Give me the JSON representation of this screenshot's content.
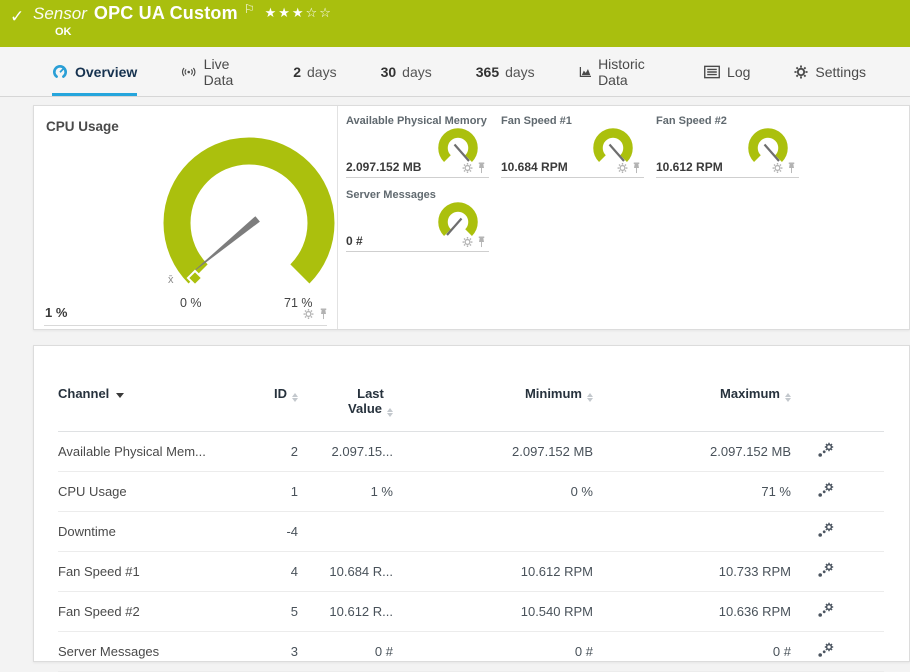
{
  "header": {
    "check_icon": "✓",
    "kind": "Sensor",
    "name": "OPC UA Custom",
    "flag_icon": "⚐",
    "stars": "★★★☆☆",
    "status": "OK"
  },
  "tabs": [
    {
      "label": "Overview"
    },
    {
      "label": "Live Data"
    },
    {
      "num": "2",
      "unit": "days"
    },
    {
      "num": "30",
      "unit": "days"
    },
    {
      "num": "365",
      "unit": "days"
    },
    {
      "label": "Historic Data"
    },
    {
      "label": "Log"
    },
    {
      "label": "Settings"
    }
  ],
  "gauges": {
    "cpu": {
      "title": "CPU Usage",
      "current": "1 %",
      "scale_min": "0 %",
      "scale_max": "71 %",
      "mean_marker": "x̄"
    },
    "mini": [
      {
        "title": "Available Physical Memory",
        "value": "2.097.152 MB"
      },
      {
        "title": "Fan Speed #1",
        "value": "10.684 RPM"
      },
      {
        "title": "Fan Speed #2",
        "value": "10.612 RPM"
      },
      {
        "title": "Server Messages",
        "value": "0 #"
      }
    ]
  },
  "chart_data": [
    {
      "type": "gauge",
      "title": "CPU Usage",
      "value": 1,
      "min": 0,
      "max": 71,
      "unit": "%"
    },
    {
      "type": "gauge",
      "title": "Available Physical Memory",
      "value": 2097152,
      "unit": "MB"
    },
    {
      "type": "gauge",
      "title": "Fan Speed #1",
      "value": 10684,
      "unit": "RPM"
    },
    {
      "type": "gauge",
      "title": "Fan Speed #2",
      "value": 10612,
      "unit": "RPM"
    },
    {
      "type": "gauge",
      "title": "Server Messages",
      "value": 0,
      "unit": "#"
    }
  ],
  "table": {
    "headers": {
      "channel": "Channel",
      "id": "ID",
      "last_line1": "Last",
      "last_line2": "Value",
      "minimum": "Minimum",
      "maximum": "Maximum"
    },
    "rows": [
      {
        "channel": "Available Physical Mem...",
        "id": "2",
        "last": "2.097.15...",
        "min": "2.097.152 MB",
        "max": "2.097.152 MB"
      },
      {
        "channel": "CPU Usage",
        "id": "1",
        "last": "1 %",
        "min": "0 %",
        "max": "71 %"
      },
      {
        "channel": "Downtime",
        "id": "-4",
        "last": "",
        "min": "",
        "max": ""
      },
      {
        "channel": "Fan Speed #1",
        "id": "4",
        "last": "10.684 R...",
        "min": "10.612 RPM",
        "max": "10.733 RPM"
      },
      {
        "channel": "Fan Speed #2",
        "id": "5",
        "last": "10.612 R...",
        "min": "10.540 RPM",
        "max": "10.636 RPM"
      },
      {
        "channel": "Server Messages",
        "id": "3",
        "last": "0 #",
        "min": "0 #",
        "max": "0 #"
      }
    ]
  },
  "colors": {
    "brand_green": "#a9bf0e",
    "gauge_lime": "#abc00d",
    "accent_blue": "#25a5dc"
  }
}
